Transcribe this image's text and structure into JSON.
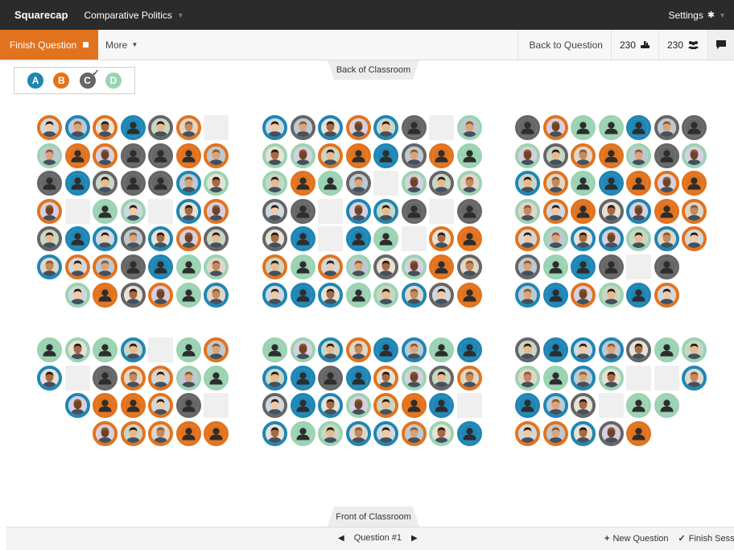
{
  "navbar": {
    "brand": "Squarecap",
    "course": "Comparative Politics",
    "settings_label": "Settings"
  },
  "toolbar": {
    "finish_question_label": "Finish Question",
    "more_label": "More",
    "back_to_question_label": "Back to Question",
    "responded_count": "230",
    "present_count": "230"
  },
  "legend": [
    {
      "letter": "A",
      "color": "#1f86b5"
    },
    {
      "letter": "B",
      "color": "#e2731e"
    },
    {
      "letter": "C",
      "color": "#666666"
    },
    {
      "letter": "D",
      "color": "#9bd3b2"
    }
  ],
  "classroom": {
    "back_label": "Back of Classroom",
    "front_label": "Front of Classroom"
  },
  "footer": {
    "question_label": "Question #1",
    "new_question_label": "New Question",
    "finish_session_label": "Finish Session"
  },
  "answer_colors": {
    "A": "#1f86b5",
    "B": "#e2731e",
    "C": "#666666",
    "D": "#9bd3b2"
  },
  "seating": {
    "legend_note": "Each seat: answer letter + kind (p = photo, s = silhouette), '.' = empty seat, ' ' = no seat",
    "sections": [
      {
        "rows": [
          [
            "Bp",
            "Ap",
            "Bp",
            "As",
            "Cp",
            "Bp",
            "."
          ],
          [
            "Dp",
            "Bs",
            "Bp",
            "Cs",
            "Cs",
            "Bs",
            "Bp"
          ],
          [
            "Cs",
            "As",
            "Cp",
            "Cs",
            "Cs",
            "Ap",
            "Dp"
          ],
          [
            "Bp",
            ".",
            "Ds",
            "Dp",
            ".",
            "Ap",
            "Bp"
          ],
          [
            "Cp",
            "As",
            "Ap",
            "Cp",
            "Ap",
            "Bp",
            "Cp"
          ],
          [
            "Ap",
            "Bp",
            "Bp",
            "Cs",
            "As",
            "Ds",
            "Dp"
          ],
          [
            " ",
            "Dp",
            "Bs",
            "Cp",
            "Bp",
            "Ds",
            "Ap"
          ]
        ]
      },
      {
        "rows": [
          [
            "Ap",
            "Cp",
            "Ap",
            "Bp",
            "Ap",
            "Cs",
            ".",
            "Dp"
          ],
          [
            "Dp",
            "Dp",
            "Bp",
            "Bs",
            "As",
            "Cp",
            "Bs",
            "Ds"
          ],
          [
            "Dp",
            "Bs",
            "Ds",
            "Cp",
            ".",
            "Dp",
            "Cp",
            "Dp"
          ],
          [
            "Cp",
            "Cs",
            ".",
            "Ap",
            "Ap",
            "Cs",
            ".",
            "Cs"
          ],
          [
            "Cp",
            "As",
            ".",
            "As",
            "Ds",
            ".",
            "Bp",
            "Bs"
          ],
          [
            "Bp",
            "Ds",
            "Bp",
            "Dp",
            "Cp",
            "Dp",
            "Bs",
            "Cp"
          ],
          [
            "Ap",
            "As",
            "Ap",
            "Ds",
            "Dp",
            "Ap",
            "Cp",
            "Bs"
          ]
        ]
      },
      {
        "rows": [
          [
            "Cs",
            "Bp",
            "Ds",
            "Ds",
            "As",
            "Cp",
            "Cs"
          ],
          [
            "Dp",
            "Cp",
            "Bp",
            "Bs",
            "Dp",
            "Cs",
            "Dp"
          ],
          [
            "Ap",
            "Bp",
            "Ds",
            "As",
            "Bs",
            "Bp",
            "Bs"
          ],
          [
            "Dp",
            "Bp",
            "Bs",
            "Cp",
            "Ap",
            "Bs",
            "Bp"
          ],
          [
            "Bp",
            "Dp",
            "Ap",
            "Ap",
            "Dp",
            "Ap",
            "Bp"
          ],
          [
            "Cp",
            "Ds",
            "As",
            "Cs",
            ".",
            "Cs"
          ],
          [
            "Ap",
            "As",
            "Bp",
            "Dp",
            "As",
            "Bp"
          ]
        ]
      },
      {
        "rows": [
          [
            "Ds",
            "Dp",
            "Ds",
            "Ap",
            ".",
            "Ds",
            "Bp"
          ],
          [
            "Ap",
            ".",
            "Cs",
            "Bp",
            "Bp",
            "Dp",
            "Ds"
          ],
          [
            " ",
            "Ap",
            "Bs",
            "Bs",
            "Bp",
            "Cs",
            "."
          ],
          [
            " ",
            " ",
            "Bp",
            "Bp",
            "Bp",
            "Bs",
            "Bs"
          ]
        ]
      },
      {
        "rows": [
          [
            "Ds",
            "Dp",
            "Ap",
            "Bp",
            "As",
            "Ap",
            "Ds",
            "As"
          ],
          [
            "Ap",
            "As",
            "Cs",
            "As",
            "Bp",
            "Dp",
            "Cp",
            "Bp"
          ],
          [
            "Cp",
            "As",
            "Ap",
            "Dp",
            "Bp",
            "Bs",
            "As",
            "."
          ],
          [
            "Ap",
            "Ds",
            "Dp",
            "Ap",
            "Ap",
            "Bp",
            "Dp",
            "As"
          ]
        ]
      },
      {
        "rows": [
          [
            "Cp",
            "As",
            "Ap",
            "Ap",
            "Cp",
            "Ds",
            "Dp"
          ],
          [
            "Dp",
            "Ds",
            "Ap",
            "Dp",
            ".",
            ".",
            "Ap"
          ],
          [
            "As",
            "Ap",
            "Cp",
            ".",
            "Ds",
            "Ds"
          ],
          [
            "Bp",
            "Bp",
            "Ap",
            "Cp",
            "Bs"
          ]
        ]
      }
    ]
  }
}
